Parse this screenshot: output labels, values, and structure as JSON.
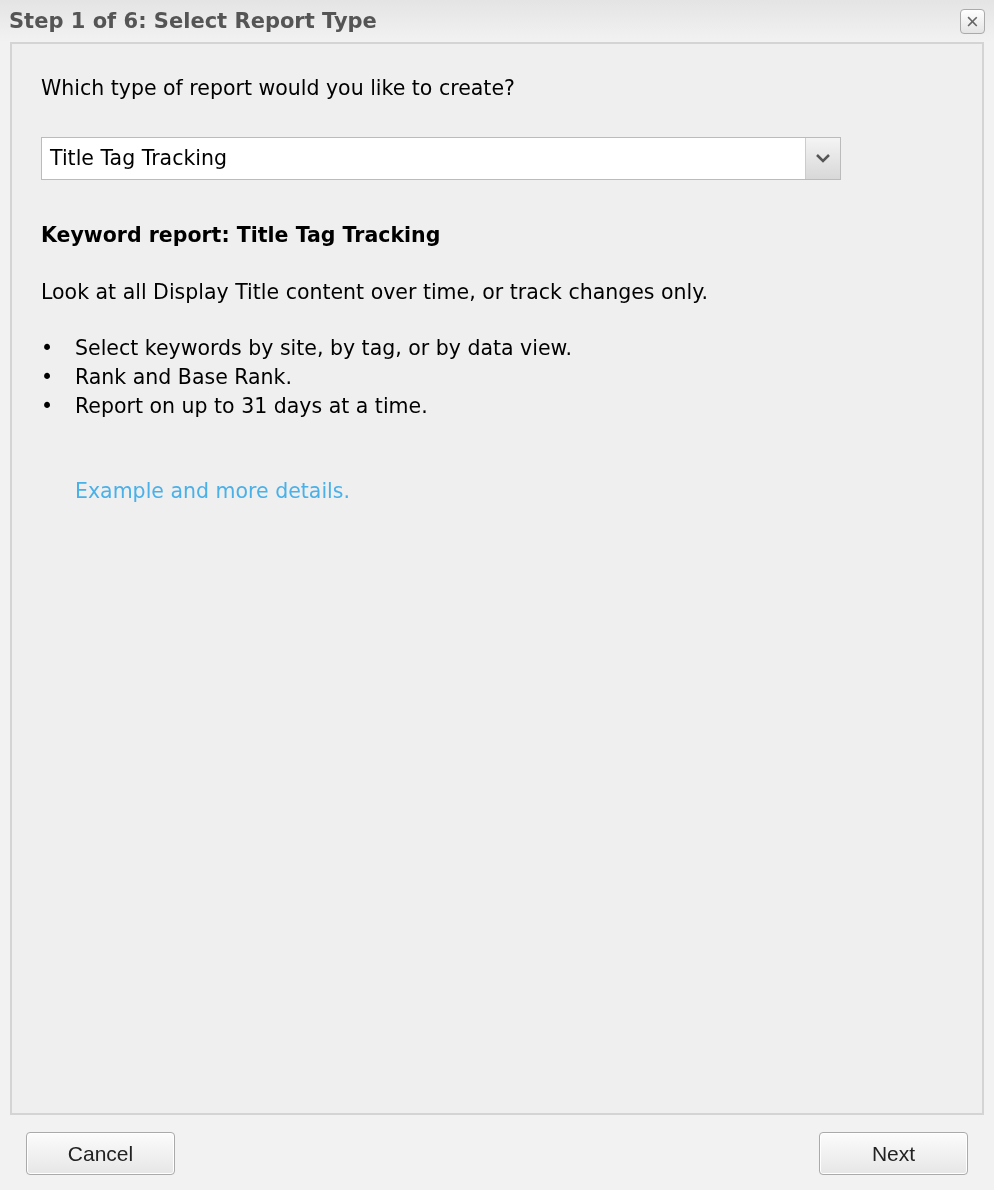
{
  "window": {
    "title": "Step 1 of 6: Select Report Type",
    "close_icon": "×"
  },
  "question": "Which type of report would you like to create?",
  "report_type": {
    "value": "Title Tag Tracking"
  },
  "description": {
    "heading": "Keyword report: Title Tag Tracking",
    "summary": "Look at all Display Title content over time, or track changes only.",
    "features": [
      {
        "bullet": "•",
        "text": "Select keywords by site, by tag, or by data view."
      },
      {
        "bullet": "•",
        "text": "Rank and Base Rank."
      },
      {
        "bullet": "•",
        "text": "Report on up to 31 days at a time."
      }
    ],
    "link": "Example and more details."
  },
  "buttons": [
    {
      "label": "Cancel"
    },
    {
      "label": "Next"
    }
  ]
}
